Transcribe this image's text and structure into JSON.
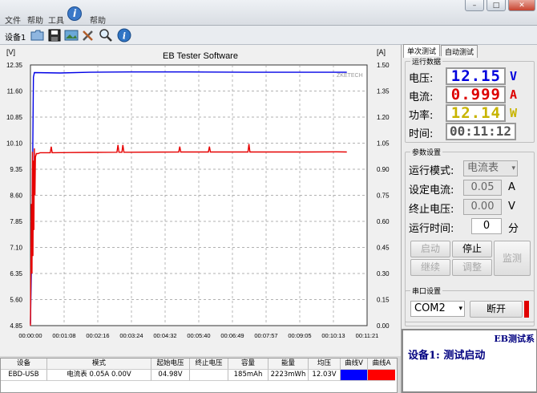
{
  "menubar": {
    "items": [
      "文件",
      "帮助",
      "工具",
      "帮助"
    ],
    "window_buttons": [
      "–",
      "□",
      "✕"
    ]
  },
  "toolbar": {
    "device_label": "设备1",
    "icons": [
      "folder-icon",
      "save-icon",
      "image-icon",
      "tools-icon",
      "zoom-icon",
      "info-icon"
    ]
  },
  "chart_data": {
    "type": "line",
    "title": "EB Tester Software",
    "y_left_unit": "[V]",
    "y_right_unit": "[A]",
    "watermark": "ZKETECH",
    "ylim_left": [
      4.85,
      12.35
    ],
    "ylim_right": [
      0.0,
      1.5
    ],
    "y_left_ticks": [
      "12.35",
      "11.60",
      "10.85",
      "10.10",
      "9.35",
      "8.60",
      "7.85",
      "7.10",
      "6.35",
      "5.60",
      "4.85"
    ],
    "y_right_ticks": [
      "1.50",
      "1.35",
      "1.20",
      "1.05",
      "0.90",
      "0.75",
      "0.60",
      "0.45",
      "0.30",
      "0.15",
      "0.00"
    ],
    "x_ticks": [
      "00:00:00",
      "00:01:08",
      "00:02:16",
      "00:03:24",
      "00:04:32",
      "00:05:40",
      "00:06:49",
      "00:07:57",
      "00:09:05",
      "00:10:13",
      "00:11:21"
    ],
    "xlim_seconds": [
      0,
      681
    ],
    "grid": true,
    "series": [
      {
        "name": "曲线V",
        "color": "#0000e6",
        "axis": "left",
        "x": [
          0,
          3,
          6,
          8,
          60,
          120,
          200,
          320,
          440,
          560,
          640
        ],
        "y": [
          4.9,
          7.5,
          12.0,
          12.13,
          12.12,
          12.14,
          12.15,
          12.15,
          12.14,
          12.14,
          12.14
        ]
      },
      {
        "name": "曲线A",
        "color": "#e60000",
        "axis": "right",
        "x": [
          0,
          2,
          3,
          4,
          5,
          6,
          7,
          8,
          9,
          10,
          12,
          15,
          20,
          40,
          42,
          44,
          80,
          120,
          175,
          177,
          179,
          185,
          187,
          189,
          200,
          300,
          302,
          304,
          360,
          362,
          364,
          440,
          442,
          444,
          480,
          560,
          620,
          640
        ],
        "y": [
          0.0,
          0.7,
          0.3,
          1.0,
          0.4,
          0.95,
          0.55,
          1.02,
          0.75,
          0.97,
          0.99,
          0.99,
          0.995,
          0.995,
          1.03,
          0.995,
          0.996,
          0.997,
          0.998,
          1.04,
          0.998,
          0.998,
          1.04,
          0.998,
          0.998,
          0.999,
          1.03,
          0.999,
          0.999,
          1.03,
          0.999,
          0.999,
          1.045,
          0.999,
          0.999,
          0.999,
          1.0,
          0.999
        ]
      }
    ]
  },
  "table": {
    "headers": [
      "设备",
      "模式",
      "起始电压",
      "终止电压",
      "容量",
      "能量",
      "均压",
      "曲线V",
      "曲线A"
    ],
    "row": [
      "EBD-USB",
      "电流表  0.05A  0.00V",
      "04.98V",
      "",
      "185mAh",
      "2223mWh",
      "12.03V",
      "",
      ""
    ],
    "swatch_v": "#0000ff",
    "swatch_a": "#ff0000"
  },
  "panel": {
    "tabs": [
      "单次测试",
      "自动测试"
    ],
    "running_group": "运行数据",
    "voltage_label": "电压:",
    "voltage_value": "12.15",
    "voltage_unit": "V",
    "current_label": "电流:",
    "current_value": "0.999",
    "current_unit": "A",
    "power_label": "功率:",
    "power_value": "12.14",
    "power_unit": "W",
    "time_label": "时间:",
    "time_value": "00:11:12",
    "colors": {
      "voltage": "#0000dd",
      "current": "#dd0000",
      "power": "#c8b400",
      "time": "#555555"
    },
    "params_group": "参数设置",
    "mode_label": "运行模式:",
    "mode_value": "电流表",
    "set_current_label": "设定电流:",
    "set_current_value": "0.05",
    "set_current_unit": "A",
    "stop_voltage_label": "终止电压:",
    "stop_voltage_value": "0.00",
    "stop_voltage_unit": "V",
    "run_time_label": "运行时间:",
    "run_time_value": "0",
    "run_time_unit": "分",
    "btn_start": "启动",
    "btn_stop": "停止",
    "btn_monitor": "监测",
    "btn_continue": "继续",
    "btn_adjust": "调整",
    "serial_group": "串口设置",
    "com_value": "COM2",
    "btn_disconnect": "断开",
    "status_title": "EB测试系",
    "status_text": "设备1: 测试启动"
  }
}
